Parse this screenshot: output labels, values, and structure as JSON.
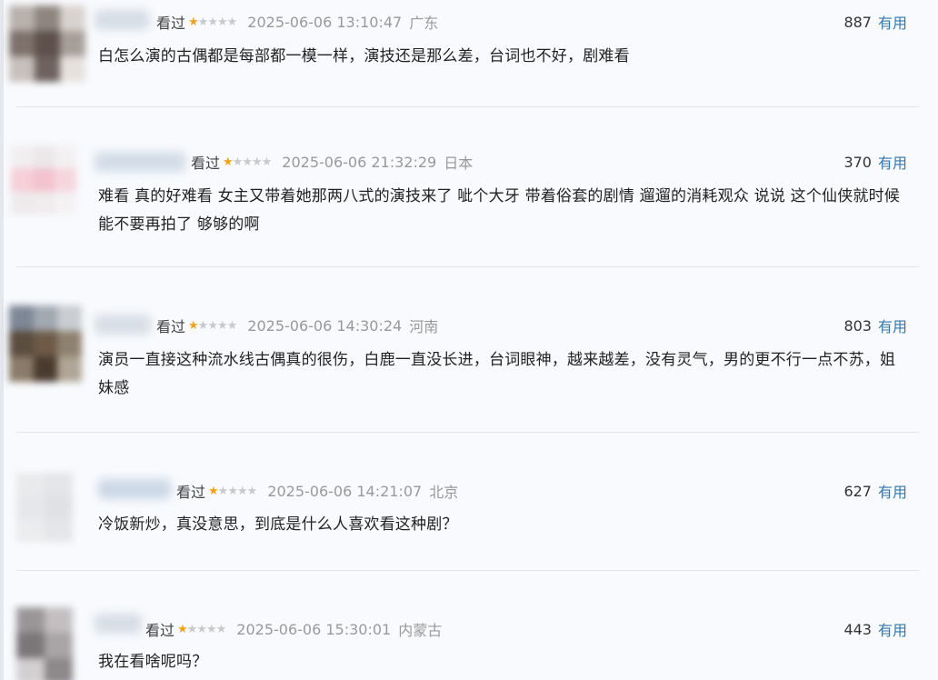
{
  "comments": [
    {
      "rated_label": "看过",
      "rating": 1,
      "max_rating": 5,
      "time": "2025-06-06 13:10:47",
      "location": "广东",
      "votes": "887",
      "vote_label": "有用",
      "text": "白怎么演的古偶都是每部都一模一样，演技还是那么差，台词也不好，剧难看"
    },
    {
      "rated_label": "看过",
      "rating": 1,
      "max_rating": 5,
      "time": "2025-06-06 21:32:29",
      "location": "日本",
      "votes": "370",
      "vote_label": "有用",
      "text": "难看 真的好难看 女主又带着她那两八式的演技来了 呲个大牙 带着俗套的剧情 遛遛的消耗观众 说说 这个仙侠就时候能不要再拍了 够够的啊"
    },
    {
      "rated_label": "看过",
      "rating": 1,
      "max_rating": 5,
      "time": "2025-06-06 14:30:24",
      "location": "河南",
      "votes": "803",
      "vote_label": "有用",
      "text": "演员一直接这种流水线古偶真的很伤，白鹿一直没长进，台词眼神，越来越差，没有灵气，男的更不行一点不苏，姐妹感"
    },
    {
      "rated_label": "看过",
      "rating": 1,
      "max_rating": 5,
      "time": "2025-06-06 14:21:07",
      "location": "北京",
      "votes": "627",
      "vote_label": "有用",
      "text": "冷饭新炒，真没意思，到底是什么人喜欢看这种剧？"
    },
    {
      "rated_label": "看过",
      "rating": 1,
      "max_rating": 5,
      "time": "2025-06-06 15:30:01",
      "location": "内蒙古",
      "votes": "443",
      "vote_label": "有用",
      "text": "我在看啥呢吗？"
    }
  ]
}
